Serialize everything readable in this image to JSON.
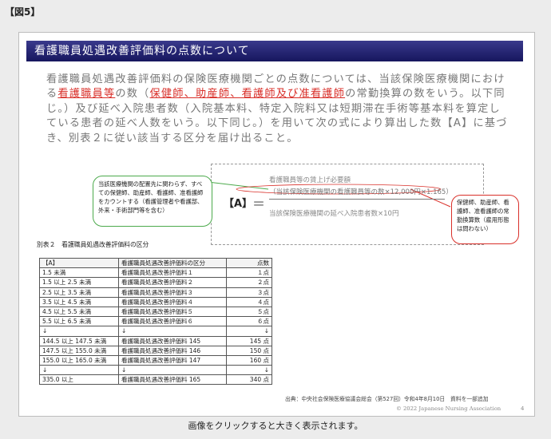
{
  "figure_label": "【図5】",
  "slide": {
    "banner_title": "看護職員処遇改善評価料の点数について",
    "paragraph": {
      "p1": "看護職員処遇改善評価料の保険医療機関ごとの点数については、当該保険医療機関における",
      "p2": "看護職員等",
      "p3": "の数（",
      "p4": "保健師、助産師、看護師及び准看護師",
      "p5": "の常勤換算の数をいう。以下同じ。）及び延べ入院患者数（入院基本料、特定入院料又は短期滞在手術等基本料を算定している患者の延べ人数をいう。以下同じ。）を用いて次の式により算出した数【A】に基づき、別表２に従い該当する区分を届け出ること。"
    },
    "callout_left": "当該医療機関の配置先に関わらず、すべての保健師、助産師、看護師、准看護師をカウントする（看護管理者や看護部、外来・手術部門等を含む）",
    "formula": {
      "label": "【A】",
      "equals": "＝",
      "numerator_line1": "看護職員等の賃上げ必要額",
      "numerator_line2": "（当該保険医療機関の看護職員等の数×12,000円×1.165）",
      "denominator": "当該保険医療機関の延べ入院患者数×10円"
    },
    "callout_right": "保健師、助産師、看護師、准看護師の常勤換算数（雇用形態は問わない）",
    "table_title": "別表２　看護職員処遇改善評価料の区分",
    "table": {
      "headers": [
        "【A】",
        "看護職員処遇改善評価料の区分",
        "点数"
      ],
      "rows": [
        [
          "1.5 未満",
          "看護職員処遇改善評価料１",
          "１点"
        ],
        [
          "1.5 以上 2.5 未満",
          "看護職員処遇改善評価料２",
          "２点"
        ],
        [
          "2.5 以上 3.5 未満",
          "看護職員処遇改善評価料３",
          "３点"
        ],
        [
          "3.5 以上 4.5 未満",
          "看護職員処遇改善評価料４",
          "４点"
        ],
        [
          "4.5 以上 5.5 未満",
          "看護職員処遇改善評価料５",
          "５点"
        ],
        [
          "5.5 以上 6.5 未満",
          "看護職員処遇改善評価料６",
          "６点"
        ],
        [
          "↓",
          "↓",
          "↓"
        ],
        [
          "144.5 以上 147.5 未満",
          "看護職員処遇改善評価料 145",
          "145 点"
        ],
        [
          "147.5 以上 155.0 未満",
          "看護職員処遇改善評価料 146",
          "150 点"
        ],
        [
          "155.0 以上 165.0 未満",
          "看護職員処遇改善評価料 147",
          "160 点"
        ],
        [
          "↓",
          "↓",
          "↓"
        ],
        [
          "335.0 以上",
          "看護職員処遇改善評価料 165",
          "340 点"
        ]
      ]
    },
    "source": "出典：中央社会保険医療協議会総会（第527回）令和4年8月10日　資料を一部追加",
    "copyright": "© 2022 Japanese Nursing Association",
    "page_number": "4"
  },
  "caption": "画像をクリックすると大きく表示されます。",
  "colors": {
    "banner": "#16165e",
    "highlight": "#d9302a",
    "callout_green": "#4caa4c"
  }
}
